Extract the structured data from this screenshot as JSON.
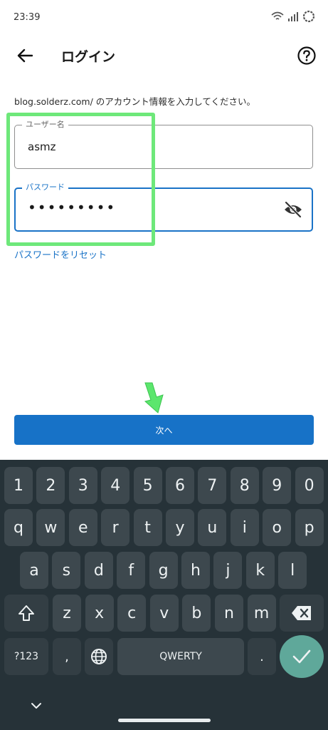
{
  "status_bar": {
    "time": "23:39"
  },
  "app_bar": {
    "title": "ログイン"
  },
  "form": {
    "instruction": "blog.solderz.com/ のアカウント情報を入力してください。",
    "username": {
      "label": "ユーザー名",
      "value": "asmz"
    },
    "password": {
      "label": "パスワード",
      "value": "•••••••••"
    },
    "reset_link": "パスワードをリセット",
    "next_label": "次へ"
  },
  "keyboard": {
    "row_numbers": [
      "1",
      "2",
      "3",
      "4",
      "5",
      "6",
      "7",
      "8",
      "9",
      "0"
    ],
    "row_1": [
      "q",
      "w",
      "e",
      "r",
      "t",
      "y",
      "u",
      "i",
      "o",
      "p"
    ],
    "row_2": [
      "a",
      "s",
      "d",
      "f",
      "g",
      "h",
      "j",
      "k",
      "l"
    ],
    "row_3": [
      "z",
      "x",
      "c",
      "v",
      "b",
      "n",
      "m"
    ],
    "symbols_key": "?123",
    "comma_key": ",",
    "space_label": "QWERTY",
    "period_key": "."
  },
  "colors": {
    "accent": "#1772c7",
    "highlight": "#6ee87a",
    "keyboard_bg": "#263238",
    "key_bg": "#3d484e",
    "enter_bg": "#5fa89a"
  },
  "icons": [
    "back-arrow-icon",
    "help-circle-icon",
    "eye-off-icon",
    "green-arrow-icon",
    "shift-icon",
    "backspace-icon",
    "globe-icon",
    "check-icon",
    "chevron-down-icon",
    "wifi-icon",
    "signal-icon",
    "battery-icon"
  ]
}
